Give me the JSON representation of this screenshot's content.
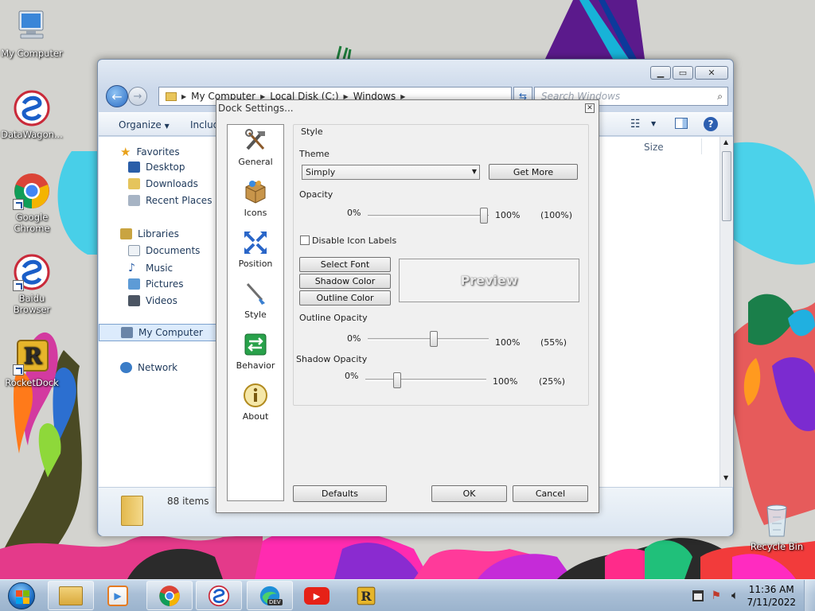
{
  "desktop": {
    "icons": [
      {
        "label": "My Computer",
        "name": "my-computer"
      },
      {
        "label": "DataWagon...",
        "name": "datawagon"
      },
      {
        "label": "Google Chrome",
        "name": "google-chrome"
      },
      {
        "label": "Baidu Browser",
        "name": "baidu-browser"
      },
      {
        "label": "RocketDock",
        "name": "rocketdock"
      },
      {
        "label": "Recycle Bin",
        "name": "recycle-bin"
      }
    ]
  },
  "explorer": {
    "breadcrumb": [
      "My Computer",
      "Local Disk (C:)",
      "Windows"
    ],
    "search_placeholder": "Search Windows",
    "toolbar": {
      "organize": "Organize",
      "include": "Includ"
    },
    "column_size": "Size",
    "nav": {
      "favorites": "Favorites",
      "desktop": "Desktop",
      "downloads": "Downloads",
      "recent": "Recent Places",
      "libraries": "Libraries",
      "documents": "Documents",
      "music": "Music",
      "pictures": "Pictures",
      "videos": "Videos",
      "computer": "My Computer",
      "network": "Network"
    },
    "status": "88 items"
  },
  "dock_settings": {
    "title": "Dock Settings...",
    "sidebar": [
      "General",
      "Icons",
      "Position",
      "Style",
      "Behavior",
      "About"
    ],
    "group_title": "Style",
    "theme_label": "Theme",
    "theme_value": "Simply",
    "get_more": "Get More",
    "opacity": {
      "label": "Opacity",
      "min": "0%",
      "max": "100%",
      "value_text": "(100%)",
      "value": 100
    },
    "disable_labels": "Disable Icon Labels",
    "select_font": "Select Font",
    "shadow_color": "Shadow Color",
    "outline_color": "Outline Color",
    "preview": "Preview",
    "outline_opacity": {
      "label": "Outline Opacity",
      "min": "0%",
      "max": "100%",
      "value_text": "(55%)",
      "value": 55
    },
    "shadow_opacity": {
      "label": "Shadow Opacity",
      "min": "0%",
      "max": "100%",
      "value_text": "(25%)",
      "value": 25
    },
    "defaults": "Defaults",
    "ok": "OK",
    "cancel": "Cancel"
  },
  "taskbar": {
    "time": "11:36 AM",
    "date": "7/11/2022",
    "edge_badge": "DEV"
  }
}
